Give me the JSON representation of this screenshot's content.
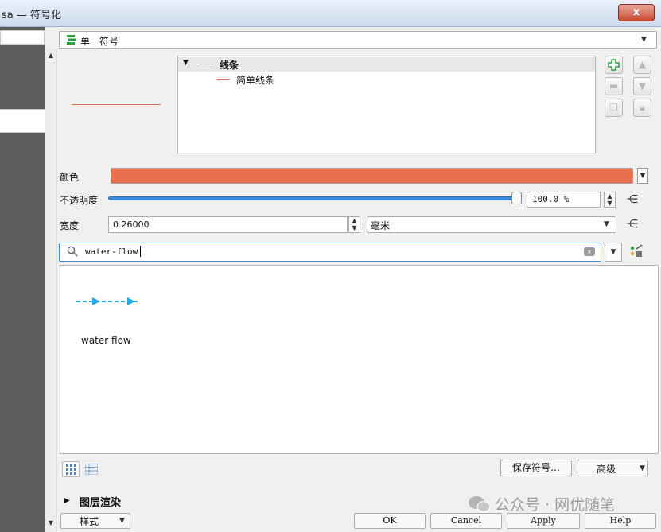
{
  "window": {
    "title": "sa — 符号化",
    "close_label": "x"
  },
  "renderer": {
    "selected": "单一符号"
  },
  "symbol_tree": {
    "root_label": "线条",
    "child_label": "简单线条"
  },
  "properties": {
    "color_label": "颜色",
    "color_value": "#e8704c",
    "opacity_label": "不透明度",
    "opacity_percent": 100,
    "opacity_value": "100.0 %",
    "width_label": "宽度",
    "width_value": "0.26000",
    "width_unit": "毫米"
  },
  "search": {
    "value": "water-flow"
  },
  "library": {
    "items": [
      {
        "label": "water flow"
      }
    ]
  },
  "buttons": {
    "save_symbol": "保存符号…",
    "advanced": "高级",
    "style": "样式",
    "ok": "OK",
    "cancel": "Cancel",
    "apply": "Apply",
    "help": "Help"
  },
  "layer_rendering": {
    "label": "图层渲染"
  },
  "watermark": {
    "text": "公众号 · 网优随笔"
  },
  "colors": {
    "accent": "#3c8be0",
    "line_symbol": "#e8735a",
    "flow_blue": "#26a9e0"
  }
}
